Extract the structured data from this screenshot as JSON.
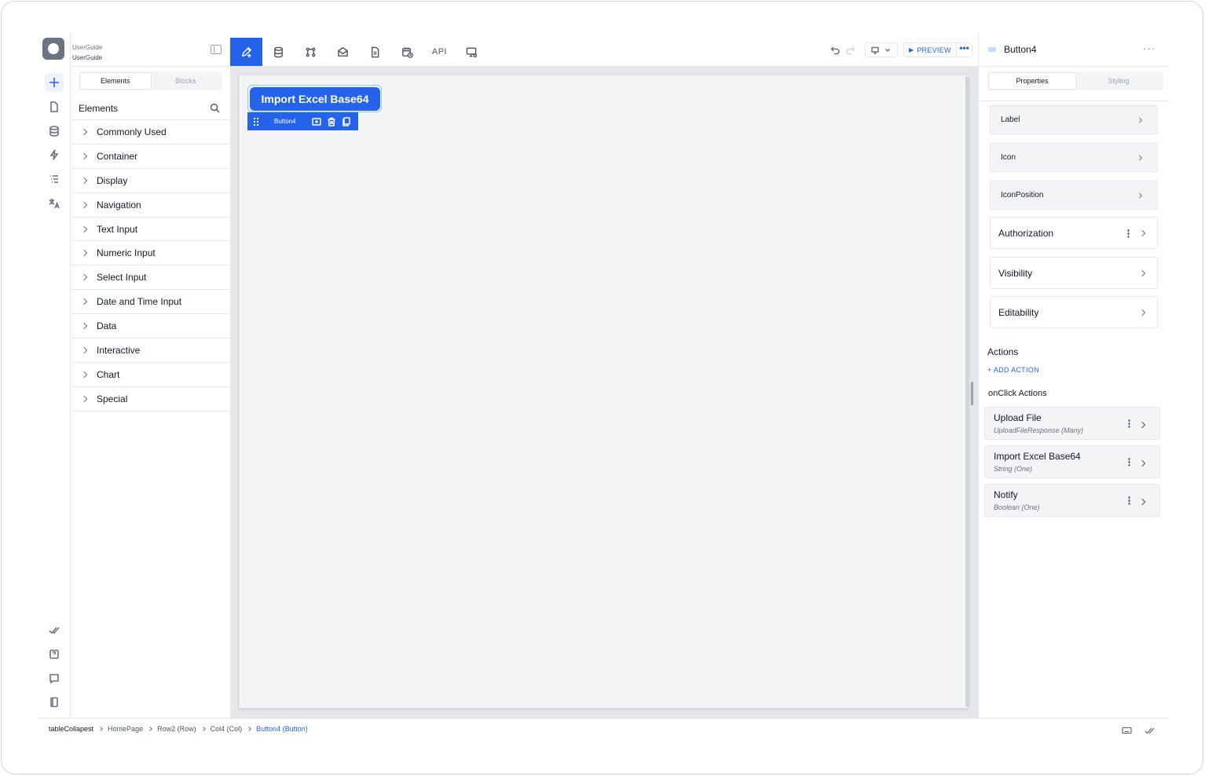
{
  "app": {
    "workspace": "UserGuide",
    "project": "UserGuide"
  },
  "toolbar": {
    "tools": [
      {
        "name": "design",
        "icon": "pen-plus-icon",
        "active": true
      },
      {
        "name": "database",
        "icon": "database-icon"
      },
      {
        "name": "workflow",
        "icon": "nodes-icon"
      },
      {
        "name": "email",
        "icon": "envelope-icon"
      },
      {
        "name": "document",
        "icon": "document-icon"
      },
      {
        "name": "scheduler",
        "icon": "calendar-clock-icon"
      },
      {
        "name": "api",
        "label": "API"
      },
      {
        "name": "screen-settings",
        "icon": "monitor-gear-icon"
      }
    ],
    "preview_label": "PREVIEW",
    "more_label": "•••"
  },
  "elements_panel": {
    "tabs": [
      "Elements",
      "Blocks"
    ],
    "selected_tab": "Elements",
    "header": "Elements",
    "categories": [
      "Commonly Used",
      "Container",
      "Display",
      "Navigation",
      "Text Input",
      "Numeric Input",
      "Select Input",
      "Date and Time Input",
      "Data",
      "Interactive",
      "Chart",
      "Special"
    ]
  },
  "canvas": {
    "button_label": "Import Excel Base64",
    "selected_name": "Button4"
  },
  "properties_panel": {
    "component_name": "Button4",
    "tabs": [
      "Properties",
      "Styling"
    ],
    "selected_tab": "Properties",
    "basic_props": [
      "Label",
      "Icon",
      "IconPosition"
    ],
    "advanced_props": [
      "Authorization",
      "Visibility",
      "Editability"
    ],
    "actions_title": "Actions",
    "add_action_label": "+ ADD ACTION",
    "onclick_title": "onClick Actions",
    "actions": [
      {
        "title": "Upload File",
        "subtitle": "UploadFileResponse (Many)"
      },
      {
        "title": "Import Excel Base64",
        "subtitle": "String (One)"
      },
      {
        "title": "Notify",
        "subtitle": "Boolean (One)"
      }
    ]
  },
  "breadcrumb": [
    "tableCollapest",
    "HomePage",
    "Row2 (Row)",
    "Col4 (Col)",
    "Button4 (Button)"
  ],
  "colors": {
    "accent": "#2563eb",
    "canvas": "#f3f4f6"
  }
}
